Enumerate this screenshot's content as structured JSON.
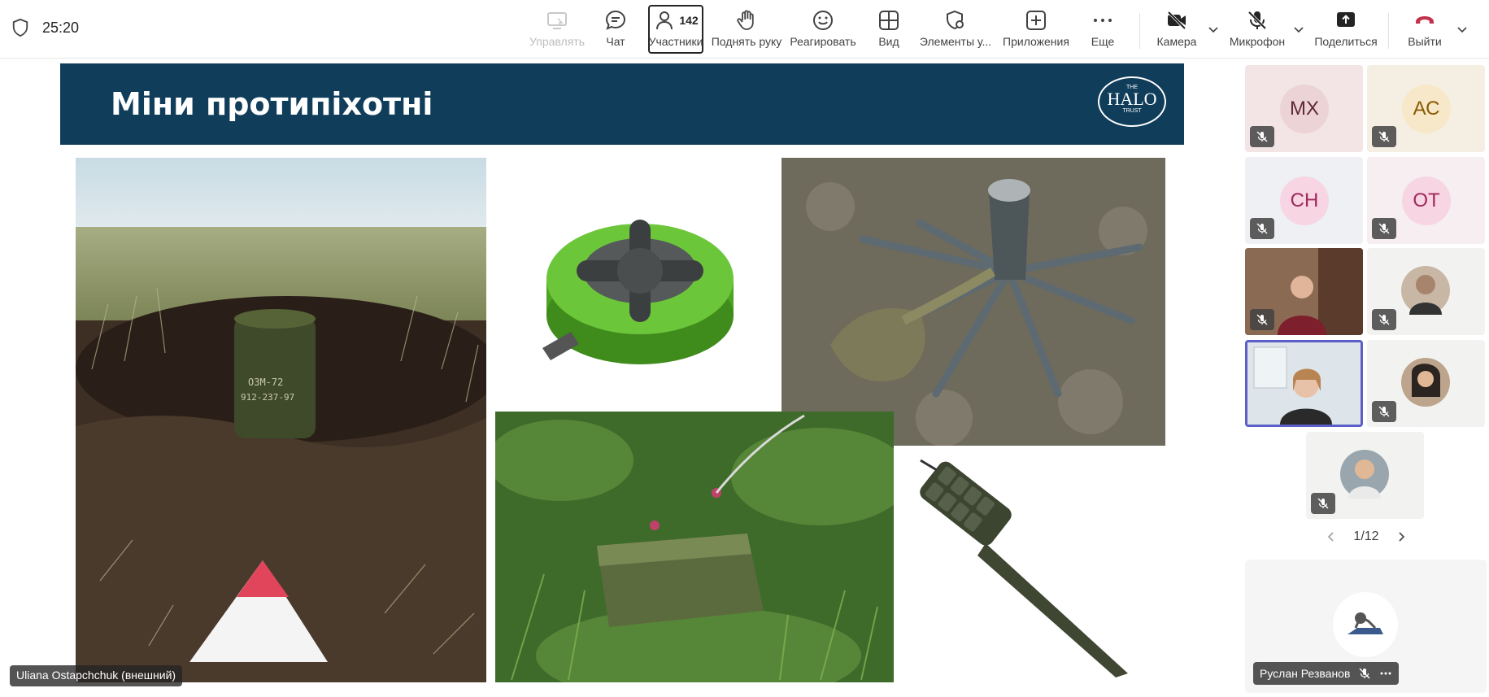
{
  "meeting": {
    "timer": "25:20"
  },
  "toolbar": {
    "manage_label": "Управлять",
    "chat_label": "Чат",
    "participants_label": "Участники",
    "participants_count": "142",
    "raise_hand_label": "Поднять руку",
    "react_label": "Реагировать",
    "view_label": "Вид",
    "elements_label": "Элементы у...",
    "apps_label": "Приложения",
    "more_label": "Еще",
    "camera_label": "Камера",
    "mic_label": "Микрофон",
    "share_label": "Поделиться",
    "leave_label": "Выйти"
  },
  "slide": {
    "title": "Міни протипіхотні",
    "logo_top": "THE",
    "logo_main": "HALO",
    "logo_bottom": "TRUST",
    "mine_marking_1": "ОЗМ-72",
    "mine_marking_2": "912-237-97"
  },
  "presenter": {
    "name": "Uliana Ostapchchuk (внешний)"
  },
  "participants": [
    {
      "initials": "МХ",
      "bg": "#f3e4e6",
      "avatar_bg": "#ecd3d6",
      "fg": "#5d2a30"
    },
    {
      "initials": "АС",
      "bg": "#f5efe3",
      "avatar_bg": "#f6e8c9",
      "fg": "#8a5a00"
    },
    {
      "initials": "СН",
      "bg": "#eef0f3",
      "avatar_bg": "#f7d5e2",
      "fg": "#a0285a"
    },
    {
      "initials": "ОТ",
      "bg": "#f6eef1",
      "avatar_bg": "#f7d5e2",
      "fg": "#a0285a"
    }
  ],
  "pager": {
    "text": "1/12"
  },
  "self": {
    "name": "Руслан Резванов"
  },
  "colors": {
    "slide_header": "#0f3d5a",
    "active_border": "#5b5fc7",
    "leave_red": "#c4314b"
  }
}
